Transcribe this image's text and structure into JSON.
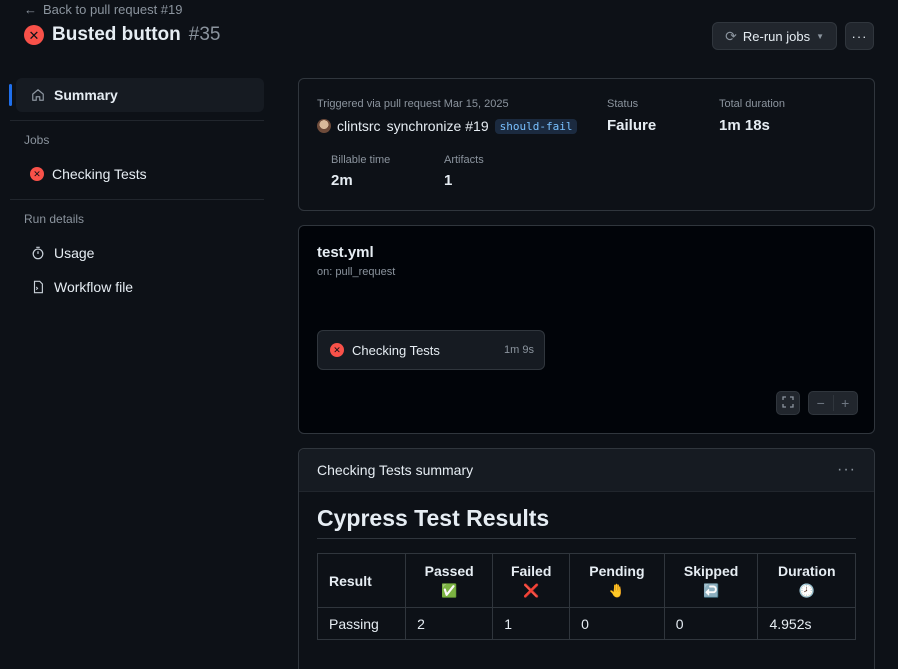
{
  "header": {
    "back_link": "Back to pull request #19",
    "title": "Busted button",
    "run_number": "#35",
    "rerun_label": "Re-run jobs"
  },
  "sidebar": {
    "summary_label": "Summary",
    "jobs_heading": "Jobs",
    "jobs": [
      {
        "label": "Checking Tests",
        "status": "failure"
      }
    ],
    "run_details_heading": "Run details",
    "usage_label": "Usage",
    "workflow_file_label": "Workflow file"
  },
  "summary": {
    "triggered_text": "Triggered via pull request Mar 15, 2025",
    "user": "clintsrc",
    "event": "synchronize",
    "pr": "#19",
    "branch_badge": "should-fail",
    "status_label": "Status",
    "status_value": "Failure",
    "duration_label": "Total duration",
    "duration_value": "1m 18s",
    "billable_label": "Billable time",
    "billable_value": "2m",
    "artifacts_label": "Artifacts",
    "artifacts_value": "1"
  },
  "graph": {
    "workflow_file": "test.yml",
    "trigger": "on: pull_request",
    "job_name": "Checking Tests",
    "job_duration": "1m 9s"
  },
  "results": {
    "panel_title": "Checking Tests summary",
    "heading": "Cypress Test Results",
    "columns": [
      {
        "label": "Result",
        "emoji": ""
      },
      {
        "label": "Passed",
        "emoji": "✅"
      },
      {
        "label": "Failed",
        "emoji": "❌"
      },
      {
        "label": "Pending",
        "emoji": "🤚"
      },
      {
        "label": "Skipped",
        "emoji": "↩️"
      },
      {
        "label": "Duration",
        "emoji": "🕗"
      }
    ],
    "row": [
      "Passing",
      "2",
      "1",
      "0",
      "0",
      "4.952s"
    ]
  },
  "colors": {
    "background": "#0d1117",
    "failure": "#f85149",
    "accent": "#1f6feb",
    "border": "#30363d"
  }
}
